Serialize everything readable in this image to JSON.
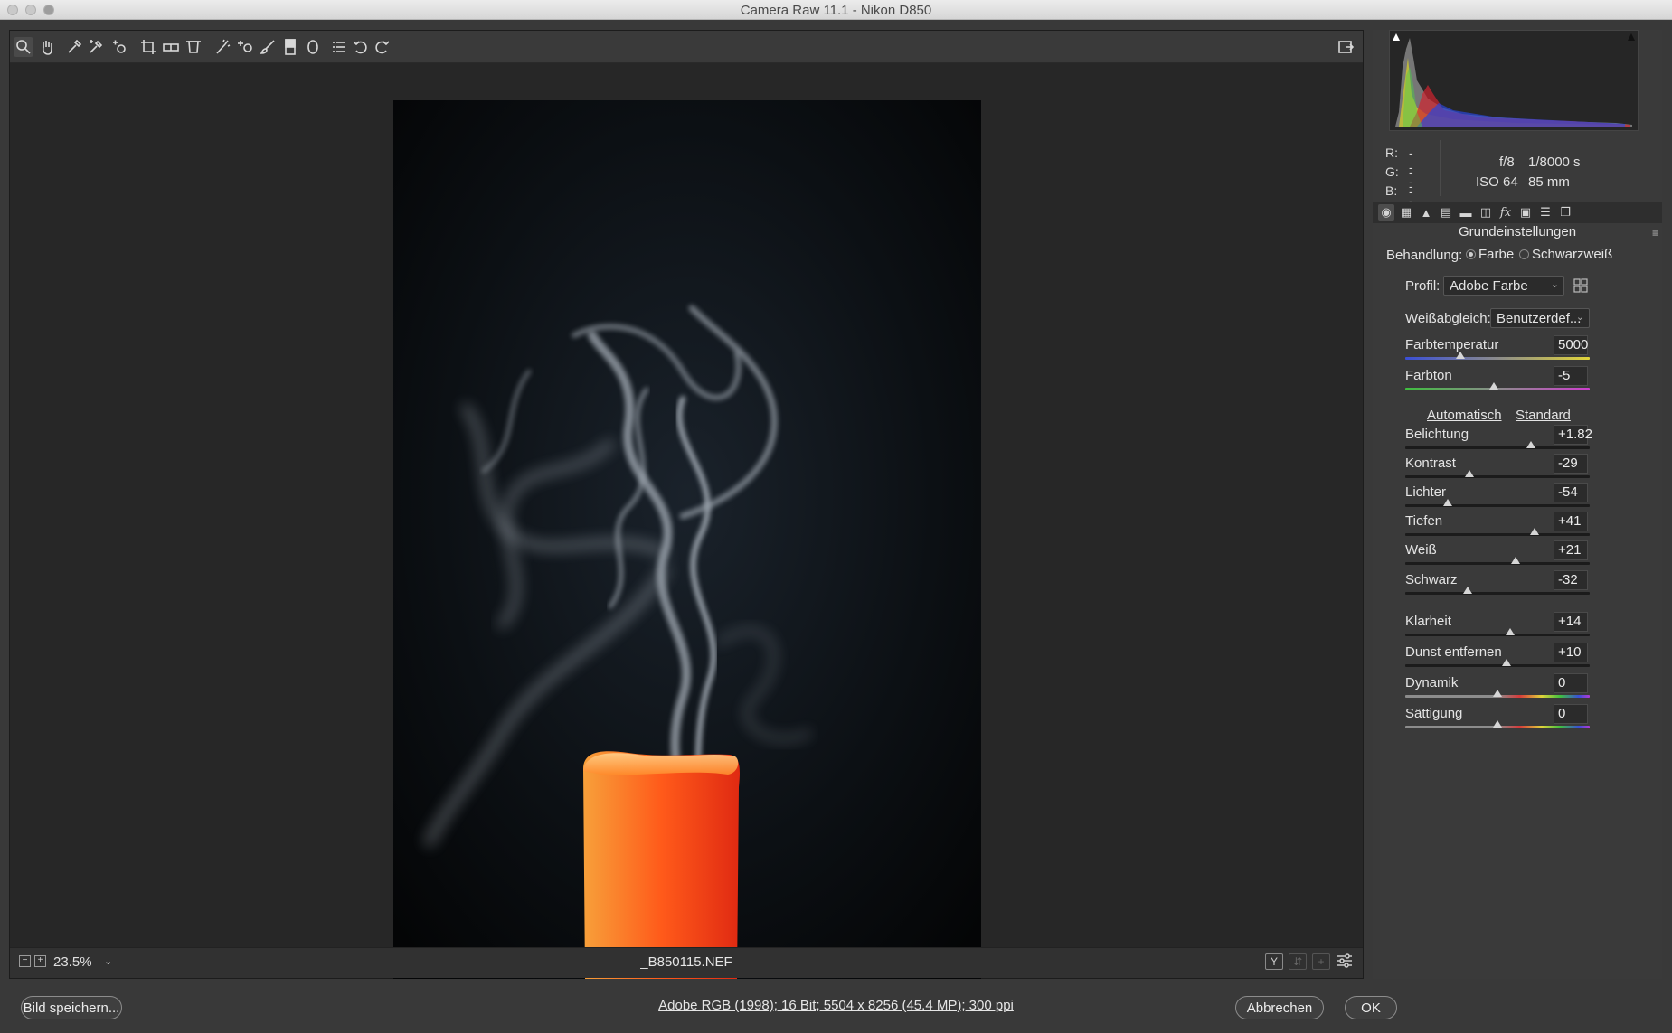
{
  "window": {
    "title": "Camera Raw 11.1 - Nikon D850"
  },
  "toolbar": {
    "tools": [
      {
        "name": "zoom-tool",
        "icon": "magnifier-icon"
      },
      {
        "name": "hand-tool",
        "icon": "hand-icon"
      },
      {
        "name": "white-balance-tool",
        "icon": "eyedropper-icon"
      },
      {
        "name": "color-sampler-tool",
        "icon": "eyedropper-plus-icon"
      },
      {
        "name": "targeted-adjustment-tool",
        "icon": "target-adjust-icon"
      },
      {
        "name": "crop-tool",
        "icon": "crop-icon"
      },
      {
        "name": "straighten-tool",
        "icon": "level-icon"
      },
      {
        "name": "transform-tool",
        "icon": "transform-icon"
      },
      {
        "name": "spot-removal-tool",
        "icon": "spot-brush-icon"
      },
      {
        "name": "red-eye-tool",
        "icon": "red-eye-icon"
      },
      {
        "name": "adjustment-brush-tool",
        "icon": "brush-icon"
      },
      {
        "name": "graduated-filter-tool",
        "icon": "gradient-icon"
      },
      {
        "name": "radial-filter-tool",
        "icon": "ellipse-icon"
      },
      {
        "name": "preferences-tool",
        "icon": "list-icon"
      },
      {
        "name": "rotate-left-tool",
        "icon": "rotate-ccw-icon"
      },
      {
        "name": "rotate-right-tool",
        "icon": "rotate-cw-icon"
      }
    ],
    "fullscreen_icon": "fullscreen-icon"
  },
  "status": {
    "zoom": "23.5%",
    "filename": "_B850115.NEF"
  },
  "readouts": {
    "r_label": "R:",
    "r_value": "---",
    "g_label": "G:",
    "g_value": "---",
    "b_label": "B:",
    "b_value": "---",
    "aperture": "f/8",
    "shutter": "1/8000 s",
    "iso": "ISO 64",
    "focal": "85 mm"
  },
  "panel": {
    "title": "Grundeinstellungen",
    "treatment_label": "Behandlung:",
    "treatment_color": "Farbe",
    "treatment_bw": "Schwarzweiß",
    "profile_label": "Profil:",
    "profile_value": "Adobe Farbe",
    "wb_label": "Weißabgleich:",
    "wb_value": "Benutzerdef...",
    "auto_label": "Automatisch",
    "default_label": "Standard"
  },
  "sliders": [
    {
      "label": "Farbtemperatur",
      "value": "5000",
      "pos": 0.3,
      "track": "temp"
    },
    {
      "label": "Farbton",
      "value": "-5",
      "pos": 0.48,
      "track": "tint"
    },
    {
      "label": "Belichtung",
      "value": "+1.82",
      "pos": 0.68,
      "track": "plain"
    },
    {
      "label": "Kontrast",
      "value": "-29",
      "pos": 0.35,
      "track": "plain"
    },
    {
      "label": "Lichter",
      "value": "-54",
      "pos": 0.23,
      "track": "plain"
    },
    {
      "label": "Tiefen",
      "value": "+41",
      "pos": 0.7,
      "track": "plain"
    },
    {
      "label": "Weiß",
      "value": "+21",
      "pos": 0.6,
      "track": "plain"
    },
    {
      "label": "Schwarz",
      "value": "-32",
      "pos": 0.34,
      "track": "plain"
    },
    {
      "label": "Klarheit",
      "value": "+14",
      "pos": 0.57,
      "track": "plain"
    },
    {
      "label": "Dunst entfernen",
      "value": "+10",
      "pos": 0.55,
      "track": "plain"
    },
    {
      "label": "Dynamik",
      "value": "0",
      "pos": 0.5,
      "track": "rainbow"
    },
    {
      "label": "Sättigung",
      "value": "0",
      "pos": 0.5,
      "track": "rainbow"
    }
  ],
  "bottom": {
    "save_label": "Bild speichern...",
    "workflow_link": "Adobe RGB (1998); 16 Bit; 5504 x 8256 (45.4 MP); 300 ppi",
    "cancel_label": "Abbrechen",
    "ok_label": "OK"
  }
}
